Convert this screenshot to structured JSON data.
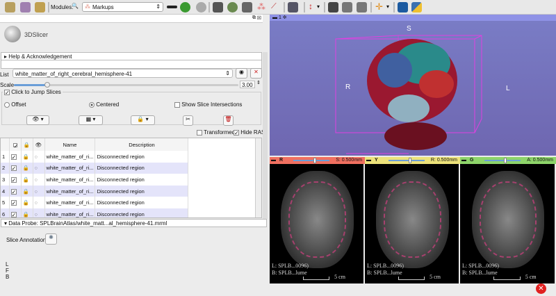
{
  "toolbar": {
    "modules_label": "Modules:",
    "module_selected": "Markups",
    "icons": [
      "data-icon",
      "dcm-icon",
      "save-icon",
      "search-icon",
      "view-icon",
      "back-icon",
      "forward-icon",
      "cube-icon",
      "brain-icon",
      "layers-icon",
      "markups-icon",
      "ruler-icon",
      "layout-icon",
      "crosshair-arrow-icon",
      "screenshot-icon",
      "scene-icon",
      "scene-view-icon",
      "fiducial-icon",
      "extension-icon",
      "python-icon"
    ]
  },
  "logo": {
    "text": "3DSlicer"
  },
  "help": {
    "label": "Help & Acknowledgement"
  },
  "list": {
    "label": "List",
    "value": "white_matter_of_right_cerebral_hemisphere-41"
  },
  "scale": {
    "label": "Scale",
    "value": "3.00",
    "fraction": 0.15
  },
  "jump": {
    "label": "Click to Jump Slices",
    "checked": true,
    "offset": "Offset",
    "centered": "Centered",
    "show_intersections": "Show Slice Intersections"
  },
  "options": {
    "transformed": "Transformed",
    "hide_ras": "Hide RAS"
  },
  "table": {
    "headers": [
      "",
      "",
      "",
      "",
      "Name",
      "Description"
    ],
    "rows": [
      {
        "n": "1",
        "name": "white_matter_of_ri...",
        "desc": "Disconnected region"
      },
      {
        "n": "2",
        "name": "white_matter_of_ri...",
        "desc": "Disconnected region"
      },
      {
        "n": "3",
        "name": "white_matter_of_ri...",
        "desc": "Disconnected region"
      },
      {
        "n": "4",
        "name": "white_matter_of_ri...",
        "desc": "Disconnected region"
      },
      {
        "n": "5",
        "name": "white_matter_of_ri...",
        "desc": "Disconnected region"
      },
      {
        "n": "6",
        "name": "white_matter_of_ri...",
        "desc": "Disconnected region"
      }
    ]
  },
  "probe": {
    "label": "Data Probe: SPLBrainAtlas/white_matt...al_hemisphere-41.mrml"
  },
  "slice_annotations": {
    "label": "Slice Annotations:"
  },
  "probe_coords": [
    "L",
    "F",
    "B"
  ],
  "view3d": {
    "number": "1",
    "labels": {
      "S": "S",
      "R": "R",
      "L": "L"
    },
    "bg": "#7470b8"
  },
  "slices": [
    {
      "letter": "R",
      "value": "S: 0.500mm",
      "color": "#f07060",
      "l": "L: SPLB...0096)",
      "b": "B: SPLB...lume",
      "scale": "5 cm"
    },
    {
      "letter": "Y",
      "value": "R: 0.500mm",
      "color": "#ede27a",
      "l": "L: SPLB...0096)",
      "b": "B: SPLB...lume",
      "scale": "5 cm"
    },
    {
      "letter": "G",
      "value": "A: 0.500mm",
      "color": "#8ed46a",
      "l": "L: SPLB...0096)",
      "b": "B: SPLB...lume",
      "scale": "5 cm"
    }
  ]
}
